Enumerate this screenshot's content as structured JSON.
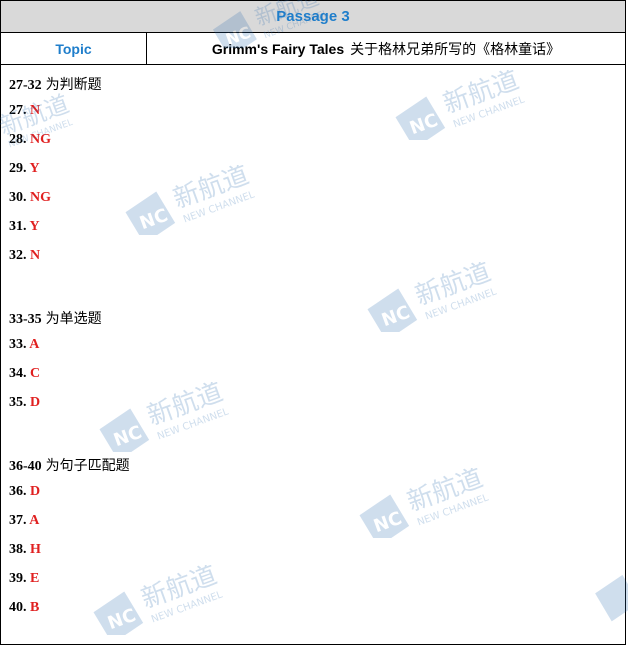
{
  "header": {
    "title": "Passage 3",
    "topic_label": "Topic",
    "topic_en": "Grimm's Fairy Tales",
    "topic_cn": "关于格林兄弟所写的《格林童话》"
  },
  "sections": [
    {
      "range": "27-32",
      "desc": "为判断题",
      "items": [
        {
          "num": "27.",
          "ans": "N"
        },
        {
          "num": "28.",
          "ans": "NG"
        },
        {
          "num": "29.",
          "ans": "Y"
        },
        {
          "num": "30.",
          "ans": "NG"
        },
        {
          "num": "31.",
          "ans": "Y"
        },
        {
          "num": "32.",
          "ans": "N"
        }
      ]
    },
    {
      "range": "33-35",
      "desc": "为单选题",
      "items": [
        {
          "num": "33.",
          "ans": "A"
        },
        {
          "num": "34.",
          "ans": "C"
        },
        {
          "num": "35.",
          "ans": "D"
        }
      ]
    },
    {
      "range": "36-40",
      "desc": "为句子匹配题",
      "items": [
        {
          "num": "36.",
          "ans": "D"
        },
        {
          "num": "37.",
          "ans": "A"
        },
        {
          "num": "38.",
          "ans": "H"
        },
        {
          "num": "39.",
          "ans": "E"
        },
        {
          "num": "40.",
          "ans": "B"
        }
      ]
    }
  ],
  "watermark": {
    "cn": "新航道",
    "en": "NEW CHANNEL",
    "badge": "NC",
    "color": "#2a6cb0"
  }
}
